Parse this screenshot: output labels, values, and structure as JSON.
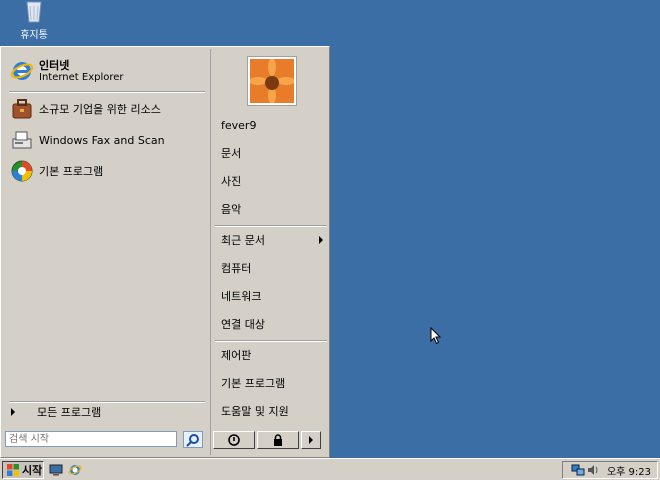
{
  "desktop": {
    "recycle_bin_label": "휴지통"
  },
  "start_menu": {
    "pinned": [
      {
        "title": "인터넷",
        "subtitle": "Internet Explorer",
        "icon": "internet-explorer-icon"
      }
    ],
    "programs": [
      {
        "label": "소규모 기업을 위한 리소스",
        "icon": "briefcase-icon"
      },
      {
        "label": "Windows Fax and Scan",
        "icon": "fax-scanner-icon"
      },
      {
        "label": "기본 프로그램",
        "icon": "default-programs-icon"
      }
    ],
    "all_programs_label": "모든 프로그램",
    "search_placeholder": "검색 시작",
    "right": {
      "user": "fever9",
      "items_a": [
        "문서",
        "사진",
        "음악"
      ],
      "items_b": [
        "최근 문서",
        "컴퓨터",
        "네트워크",
        "연결 대상"
      ],
      "items_c": [
        "제어판",
        "기본 프로그램",
        "도움말 및 지원"
      ]
    }
  },
  "taskbar": {
    "start_label": "시작",
    "clock": "오후 9:23"
  },
  "colors": {
    "desktop": "#3a6ea5",
    "menu_bg": "#d4d0c8"
  }
}
